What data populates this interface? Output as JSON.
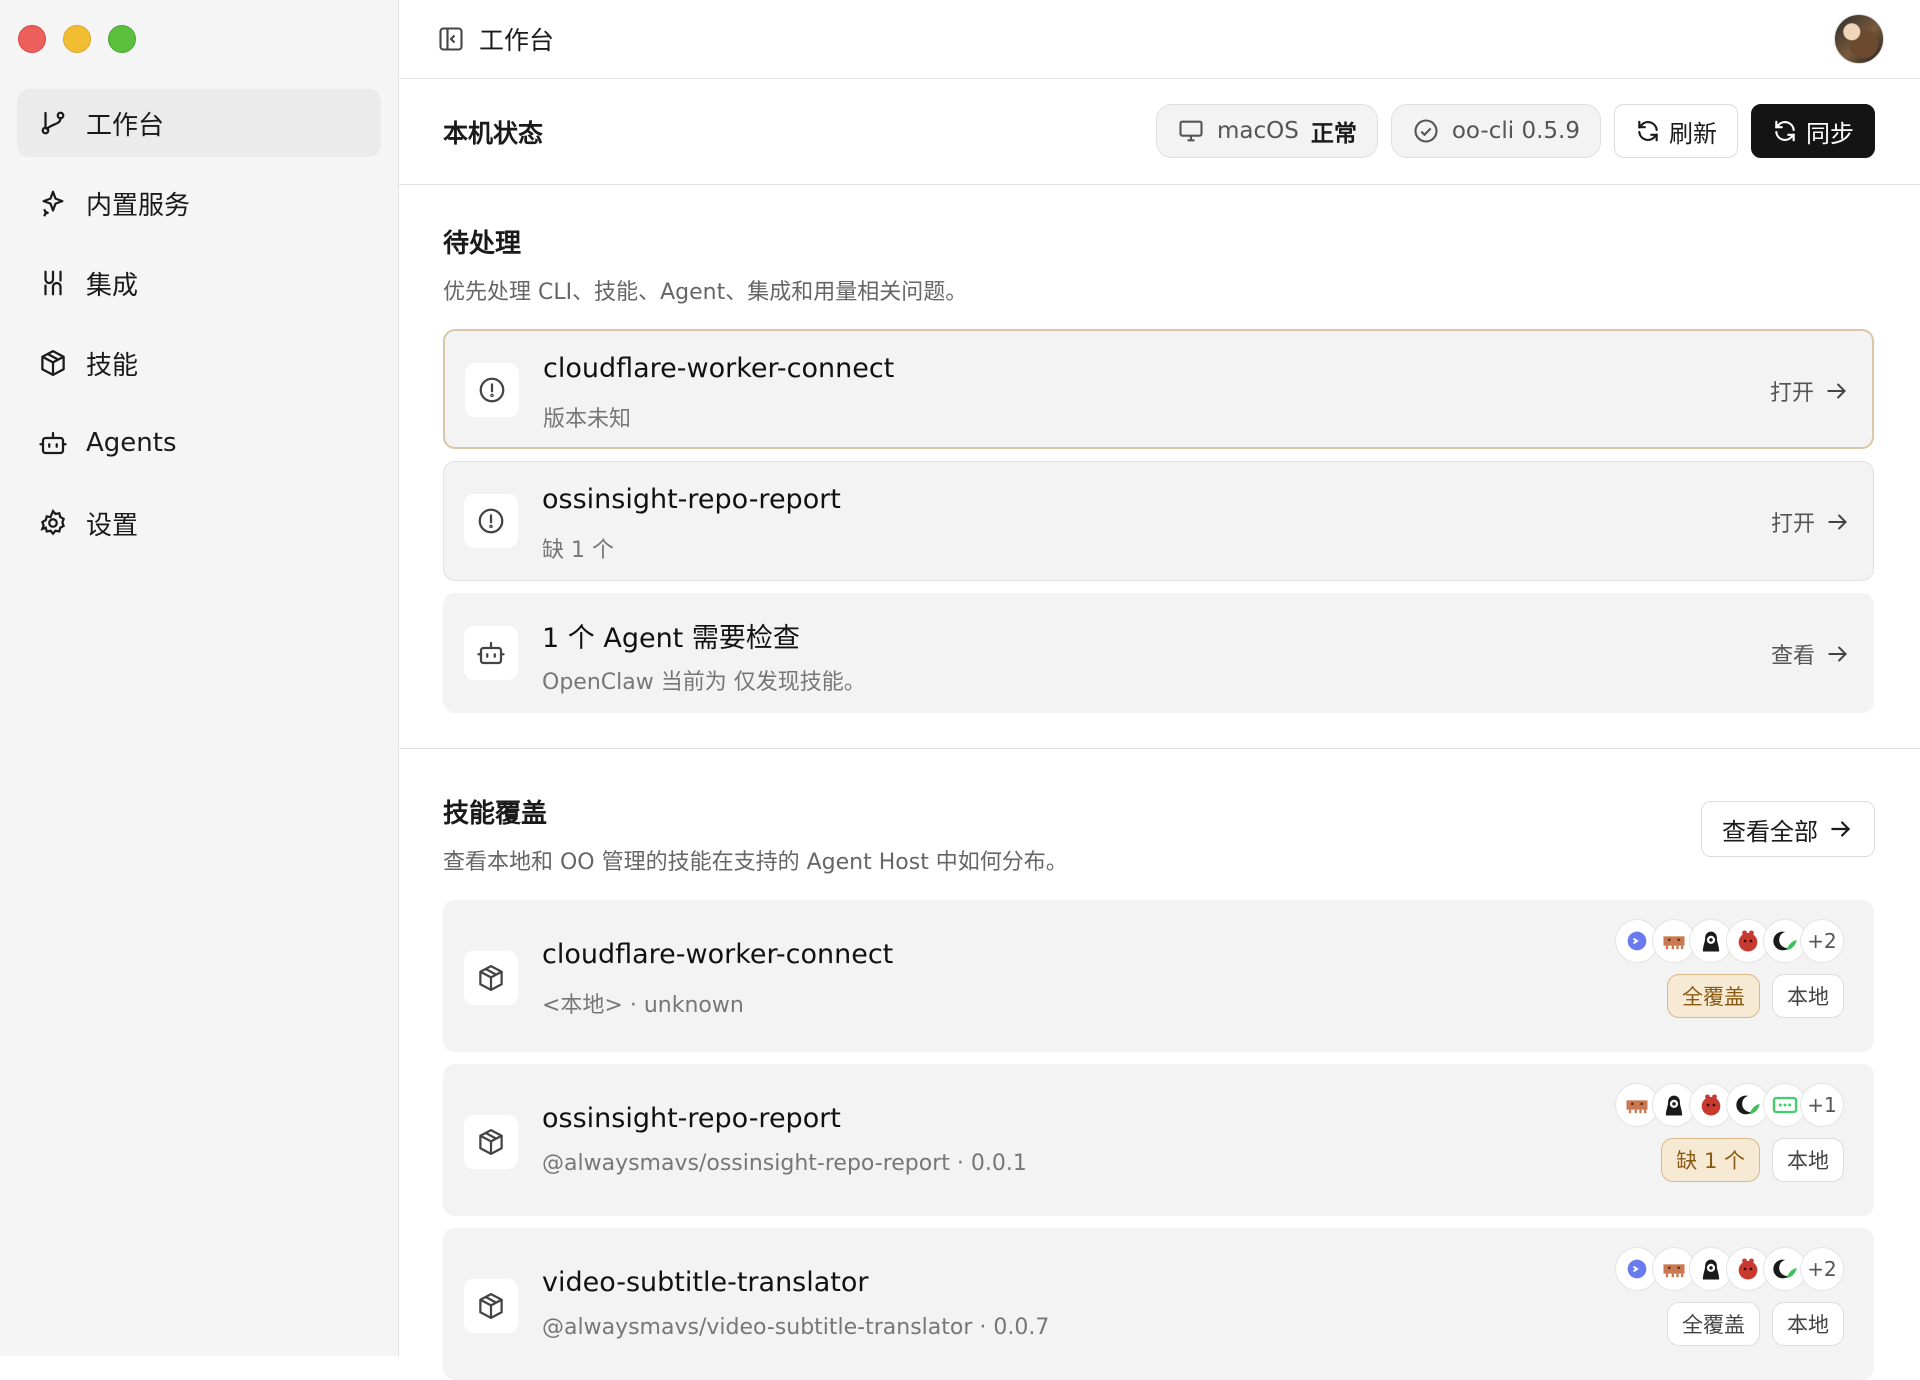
{
  "sidebar": {
    "items": [
      {
        "label": "工作台",
        "icon": "workbench-icon",
        "active": true
      },
      {
        "label": "内置服务",
        "icon": "sparkle-icon"
      },
      {
        "label": "集成",
        "icon": "integration-icon"
      },
      {
        "label": "技能",
        "icon": "package-icon"
      },
      {
        "label": "Agents",
        "icon": "bot-icon"
      },
      {
        "label": "设置",
        "icon": "gear-icon"
      }
    ]
  },
  "titlebar": {
    "title": "工作台"
  },
  "status": {
    "label": "本机状态",
    "os_name": "macOS",
    "os_state": "正常",
    "cli_version": "oo-cli 0.5.9",
    "refresh_label": "刷新",
    "sync_label": "同步"
  },
  "pending": {
    "title": "待处理",
    "description": "优先处理 CLI、技能、Agent、集成和用量相关问题。",
    "items": [
      {
        "name": "cloudflare-worker-connect",
        "sub": "版本未知",
        "action": "打开",
        "icon": "alert-circle-icon"
      },
      {
        "name": "ossinsight-repo-report",
        "sub": "缺 1 个",
        "action": "打开",
        "icon": "alert-circle-icon"
      },
      {
        "name": "1 个 Agent 需要检查",
        "sub": "OpenClaw 当前为 仅发现技能。",
        "action": "查看",
        "icon": "bot-icon"
      }
    ]
  },
  "coverage": {
    "title": "技能覆盖",
    "description": "查看本地和 OO 管理的技能在支持的 Agent Host 中如何分布。",
    "view_all_label": "查看全部",
    "items": [
      {
        "name": "cloudflare-worker-connect",
        "sub": "<本地> · unknown",
        "more": "+2",
        "badge_status": "全覆盖",
        "badge_source": "本地",
        "status_style": "gold"
      },
      {
        "name": "ossinsight-repo-report",
        "sub": "@alwaysmavs/ossinsight-repo-report · 0.0.1",
        "more": "+1",
        "badge_status": "缺 1 个",
        "badge_source": "本地",
        "status_style": "gold"
      },
      {
        "name": "video-subtitle-translator",
        "sub": "@alwaysmavs/video-subtitle-translator · 0.0.7",
        "more": "+2",
        "badge_status": "全覆盖",
        "badge_source": "本地",
        "status_style": "plain"
      }
    ]
  },
  "colors": {
    "sync_bg": "#141414",
    "warn_border": "#d8c8a8",
    "badge_gold_bg": "#f7ead4",
    "badge_gold_text": "#8b5a12"
  }
}
